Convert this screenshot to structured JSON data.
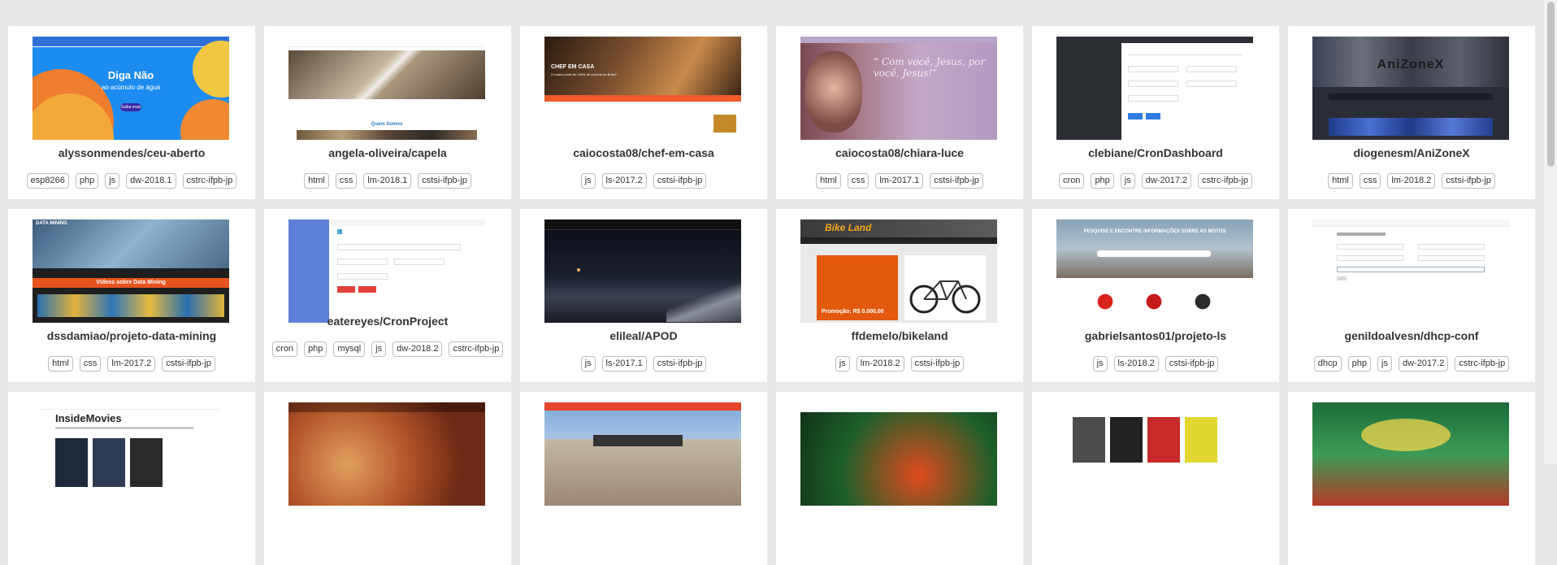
{
  "projects": [
    {
      "title": "alyssonmendes/ceu-aberto",
      "tags": [
        "esp8266",
        "php",
        "js",
        "dw-2018.1",
        "cstrc-ifpb-jp"
      ],
      "thumb": {
        "headline": "Diga Não",
        "sub": "ao acúmulo de água",
        "button": "Saiba mais"
      }
    },
    {
      "title": "angela-oliveira/capela",
      "tags": [
        "html",
        "css",
        "lm-2018.1",
        "cstsi-ifpb-jp"
      ],
      "thumb": {
        "caption": "Quem Somos"
      }
    },
    {
      "title": "caiocosta08/chef-em-casa",
      "tags": [
        "js",
        "ls-2017.2",
        "cstsi-ifpb-jp"
      ],
      "thumb": {
        "headline": "CHEF EM CASA",
        "sub": "O maior portal de Chefs de cozinha do Brasil !"
      }
    },
    {
      "title": "caiocosta08/chiara-luce",
      "tags": [
        "html",
        "css",
        "lm-2017.1",
        "cstsi-ifpb-jp"
      ],
      "thumb": {
        "quote": "“ Com você, Jesus, por você, Jesus!”"
      }
    },
    {
      "title": "clebiane/CronDashboard",
      "tags": [
        "cron",
        "php",
        "js",
        "dw-2017.2",
        "cstrc-ifpb-jp"
      ],
      "thumb": {}
    },
    {
      "title": "diogenesm/AniZoneX",
      "tags": [
        "html",
        "css",
        "lm-2018.2",
        "cstsi-ifpb-jp"
      ],
      "thumb": {
        "logo": "AniZoneX"
      }
    },
    {
      "title": "dssdamiao/projeto-data-mining",
      "tags": [
        "html",
        "css",
        "lm-2017.2",
        "cstsi-ifpb-jp"
      ],
      "thumb": {
        "brand": "DATA MINING",
        "banner": "Vídeos sobre Data Mining"
      }
    },
    {
      "title": "eatereyes/CronProject",
      "tags": [
        "cron",
        "php",
        "mysql",
        "js",
        "dw-2018.2",
        "cstrc-ifpb-jp"
      ],
      "thumb": {}
    },
    {
      "title": "elileal/APOD",
      "tags": [
        "js",
        "ls-2017.1",
        "cstsi-ifpb-jp"
      ],
      "thumb": {}
    },
    {
      "title": "ffdemelo/bikeland",
      "tags": [
        "js",
        "lm-2018.2",
        "cstsi-ifpb-jp"
      ],
      "thumb": {
        "brand": "Bike Land",
        "price": "Promoção: R$ 0.000,00"
      }
    },
    {
      "title": "gabrielsantos01/projeto-ls",
      "tags": [
        "js",
        "ls-2018.2",
        "cstsi-ifpb-jp"
      ],
      "thumb": {
        "banner": "PESQUISE E ENCONTRE INFORMAÇÕES SOBRE AS MOTOS"
      }
    },
    {
      "title": "genildoalvesn/dhcp-conf",
      "tags": [
        "dhcp",
        "php",
        "js",
        "dw-2017.2",
        "cstrc-ifpb-jp"
      ],
      "thumb": {}
    },
    {
      "title": "",
      "tags": [],
      "thumb": {
        "brand": "InsideMovies"
      }
    },
    {
      "title": "",
      "tags": [],
      "thumb": {}
    },
    {
      "title": "",
      "tags": [],
      "thumb": {}
    },
    {
      "title": "",
      "tags": [],
      "thumb": {}
    },
    {
      "title": "",
      "tags": [],
      "thumb": {}
    },
    {
      "title": "",
      "tags": [],
      "thumb": {}
    }
  ]
}
